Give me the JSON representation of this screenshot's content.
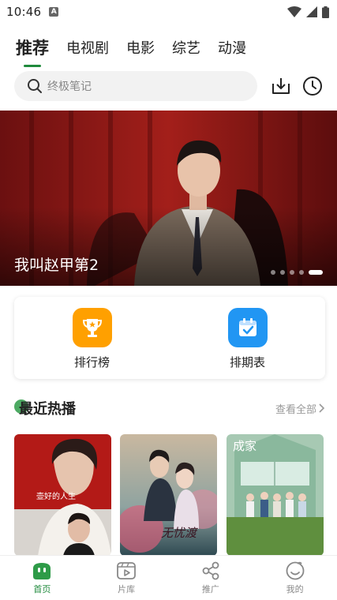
{
  "status_bar": {
    "time": "10:46",
    "notif_letter": "A"
  },
  "tabs": [
    {
      "label": "推荐",
      "active": true
    },
    {
      "label": "电视剧",
      "active": false
    },
    {
      "label": "电影",
      "active": false
    },
    {
      "label": "综艺",
      "active": false
    },
    {
      "label": "动漫",
      "active": false
    }
  ],
  "search": {
    "placeholder": "终极笔记"
  },
  "banner": {
    "title": "我叫赵甲第2",
    "dot_count": 5,
    "active_dot": 4
  },
  "quick_links": [
    {
      "label": "排行榜",
      "icon": "trophy-icon",
      "color": "#ffa000"
    },
    {
      "label": "排期表",
      "icon": "calendar-icon",
      "color": "#2196f3"
    }
  ],
  "recent": {
    "title": "最近热播",
    "more_label": "查看全部"
  },
  "posters": [
    {
      "name": "poster-1",
      "text": "壶好的人生"
    },
    {
      "name": "poster-2",
      "text": "无忧渡"
    },
    {
      "name": "poster-3",
      "text": "成家"
    }
  ],
  "bottom_nav": [
    {
      "label": "首页",
      "icon": "home-icon",
      "active": true
    },
    {
      "label": "片库",
      "icon": "video-library-icon",
      "active": false
    },
    {
      "label": "推广",
      "icon": "share-icon",
      "active": false
    },
    {
      "label": "我的",
      "icon": "profile-icon",
      "active": false
    }
  ],
  "colors": {
    "accent": "#1f8a3c",
    "banner_bg": "#4a0f0f"
  }
}
